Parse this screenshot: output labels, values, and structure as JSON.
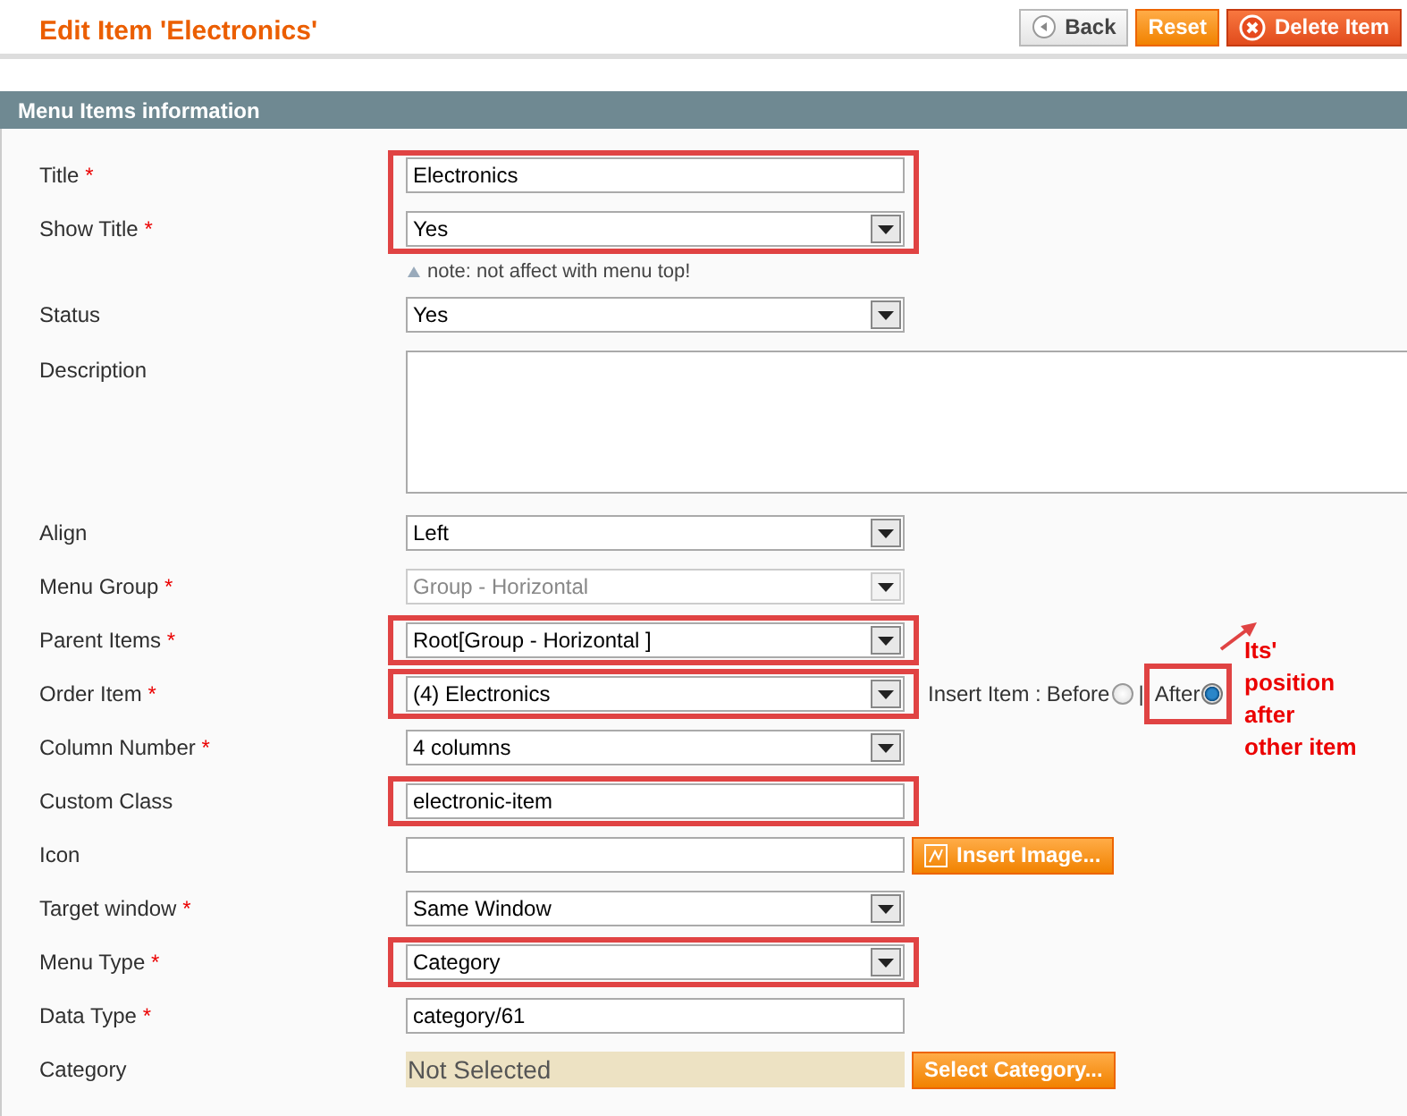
{
  "header": {
    "title": "Edit Item 'Electronics'",
    "buttons": [
      {
        "label": "Back",
        "kind": "back"
      },
      {
        "label": "Reset",
        "kind": "reset"
      },
      {
        "label": "Delete Item",
        "kind": "delete"
      }
    ]
  },
  "section": {
    "title": "Menu Items information"
  },
  "groups": [
    {
      "highlighted": true,
      "rows": [
        {
          "label": "Title",
          "required_mark": "*",
          "kind": "text",
          "value": "Electronics",
          "disabled": false
        },
        {
          "label": "Show Title",
          "required_mark": "*",
          "kind": "select",
          "value": "Yes",
          "disabled": false,
          "note": "note: not affect with menu top!"
        }
      ]
    },
    {
      "highlighted": false,
      "rows": [
        {
          "label": "Status",
          "kind": "select",
          "value": "Yes",
          "disabled": false
        },
        {
          "label": "Description",
          "kind": "textarea",
          "disabled": false
        },
        {
          "label": "Align",
          "kind": "select",
          "value": "Left",
          "disabled": false
        },
        {
          "label": "Menu Group",
          "required_mark": "*",
          "kind": "select",
          "value": "Group - Horizontal",
          "disabled": true
        }
      ]
    },
    {
      "highlighted": true,
      "rows": [
        {
          "label": "Parent Items",
          "required_mark": "*",
          "kind": "select",
          "value": "Root[Group - Horizontal ]",
          "disabled": false
        }
      ]
    },
    {
      "highlighted": true,
      "rows": [
        {
          "label": "Order Item",
          "required_mark": "*",
          "kind": "select",
          "value": "(4) Electronics",
          "disabled": false,
          "insert": {
            "label": "Insert Item :",
            "separator": "|",
            "callout": "Its' position after other item",
            "options": [
              {
                "label": "Before",
                "selected": false,
                "highlighted": false
              },
              {
                "label": "After",
                "selected": true,
                "highlighted": true
              }
            ]
          }
        }
      ]
    },
    {
      "highlighted": false,
      "rows": [
        {
          "label": "Column Number",
          "required_mark": "*",
          "kind": "select",
          "value": "4 columns",
          "disabled": false
        }
      ]
    },
    {
      "highlighted": true,
      "rows": [
        {
          "label": "Custom Class",
          "kind": "text",
          "value": "electronic-item",
          "disabled": false
        }
      ]
    },
    {
      "highlighted": false,
      "rows": [
        {
          "label": "Icon",
          "kind": "text",
          "disabled": false,
          "button": {
            "label": "Insert Image...",
            "icon": true
          }
        },
        {
          "label": "Target window",
          "required_mark": "*",
          "kind": "select",
          "value": "Same Window",
          "disabled": false
        }
      ]
    },
    {
      "highlighted": true,
      "rows": [
        {
          "label": "Menu Type",
          "required_mark": "*",
          "kind": "select",
          "value": "Category",
          "disabled": false
        }
      ]
    },
    {
      "highlighted": false,
      "rows": [
        {
          "label": "Data Type",
          "required_mark": "*",
          "kind": "text",
          "value": "category/61",
          "disabled": false
        },
        {
          "label": "Category",
          "kind": "display",
          "value": "Not Selected",
          "disabled": false,
          "button": {
            "label": "Select Category...",
            "icon": false
          }
        }
      ]
    }
  ]
}
